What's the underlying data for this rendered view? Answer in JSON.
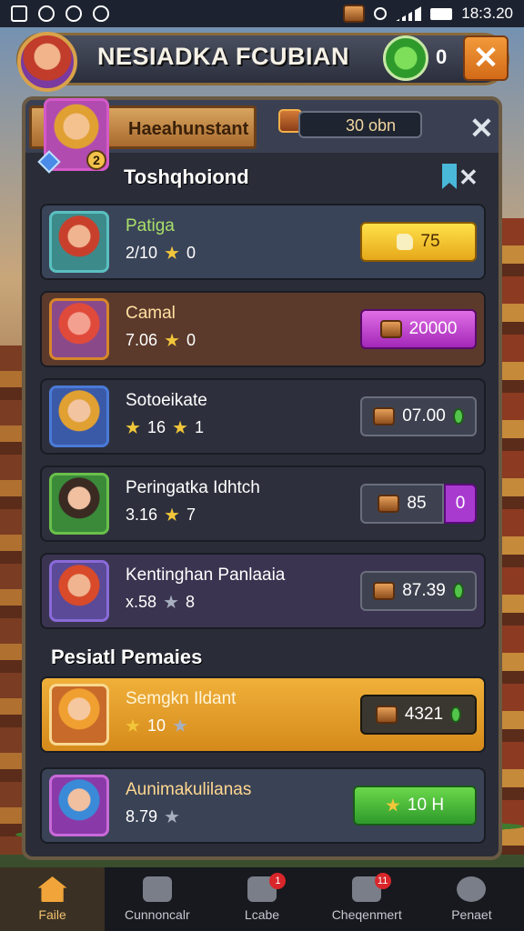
{
  "status_bar": {
    "time": "18:3.20"
  },
  "header": {
    "title": "NESIADKA FCUBIAN",
    "gem_count": "0"
  },
  "panel": {
    "tab_label": "Haeahunstant",
    "tab_level": "2",
    "coin_value": "30 obn",
    "section1_title": "Toshqhoiond",
    "section2_title": "Pesiatl Pemaies",
    "rows": [
      {
        "name": "Patiga",
        "stat1": "2/10",
        "stat2": "0",
        "button": "75",
        "color": "#3a4458"
      },
      {
        "name": "Camal",
        "stat1": "7.06",
        "stat2": "0",
        "button": "20000",
        "color": "#5b3a2c"
      },
      {
        "name": "Sotoeikate",
        "stat1": "16",
        "stat2": "1",
        "button": "07.00",
        "color": "#2d303c"
      },
      {
        "name": "Peringatka Idhtch",
        "stat1": "3.16",
        "stat2": "7",
        "button": "85",
        "badge": "0",
        "color": "#2d303c"
      },
      {
        "name": "Kentinghan Panlaaia",
        "stat1": "x.58",
        "stat2": "8",
        "button": "87.39",
        "color": "#3a3450"
      },
      {
        "name": "Semgkn Ildant",
        "stat1": "10",
        "stat2": "",
        "button": "4321",
        "color": "#e3a12e"
      },
      {
        "name": "Aunimakulilanas",
        "stat1": "8.79",
        "stat2": "",
        "button": "10 H",
        "color": "#3a4256"
      }
    ]
  },
  "nav": [
    {
      "label": "Faile"
    },
    {
      "label": "Cunnoncalr",
      "badge": ""
    },
    {
      "label": "Lcabe",
      "badge": "1"
    },
    {
      "label": "Cheqenmert",
      "badge": "11"
    },
    {
      "label": "Penaet",
      "badge": ""
    }
  ]
}
